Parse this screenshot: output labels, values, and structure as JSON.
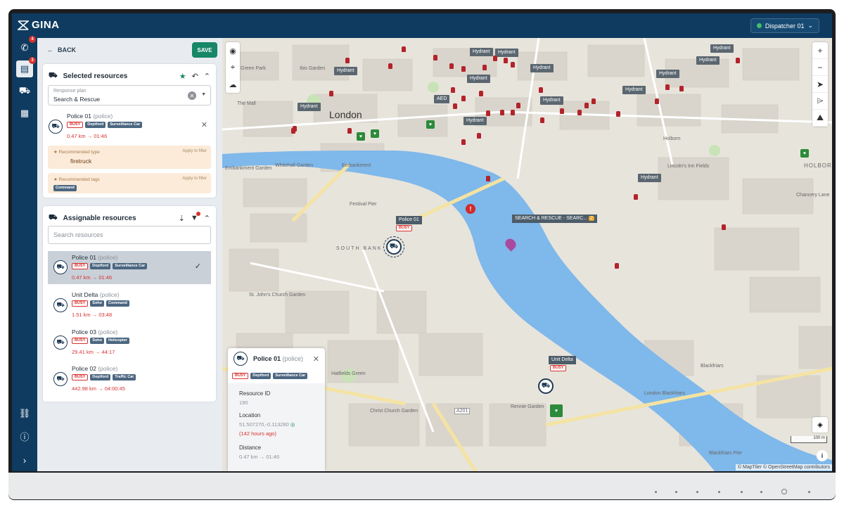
{
  "app": {
    "name": "GINA",
    "dispatcher": "Dispatcher 01"
  },
  "rail": {
    "phone_badge": "4",
    "list_badge": "3"
  },
  "panel": {
    "back_label": "BACK",
    "save_label": "SAVE",
    "selected": {
      "title": "Selected resources",
      "response_plan_label": "Response plan",
      "response_plan_value": "Search & Rescue",
      "resource": {
        "name": "Police 01",
        "type": "(police)",
        "tags": [
          "BUSY",
          "Deptford",
          "Surveillance Car"
        ],
        "distance": "0.47 km → 01:46"
      },
      "rec_type_label": "Recommended type",
      "rec_type_action": "Apply to filter",
      "rec_type_value": "firetruck",
      "rec_tags_label": "Recommended tags",
      "rec_tags_action": "Apply to filter",
      "rec_tags_value": "Command"
    },
    "assignable": {
      "title": "Assignable resources",
      "search_placeholder": "Search resources",
      "items": [
        {
          "name": "Police 01",
          "type": "(police)",
          "tags": [
            "BUSY",
            "Deptford",
            "Surveillance Car"
          ],
          "distance": "0.47 km → 01:46"
        },
        {
          "name": "Unit Delta",
          "type": "(police)",
          "tags": [
            "BUSY",
            "Soho",
            "Command"
          ],
          "distance": "1.51 km → 03:48"
        },
        {
          "name": "Police 03",
          "type": "(police)",
          "tags": [
            "BUSY",
            "Soho",
            "Helicopter"
          ],
          "distance": "29.41 km → 44:17"
        },
        {
          "name": "Police 02",
          "type": "(police)",
          "tags": [
            "BUSY",
            "Deptford",
            "Traffic Car"
          ],
          "distance": "442.98 km → 04:00:45"
        }
      ]
    }
  },
  "map": {
    "city": "London",
    "labels": [
      "SOUTH BANK",
      "Festival Pier",
      "Embankment",
      "Whitehall Garden",
      "St. John's Church Garden",
      "Hatfields Green",
      "Christ Church Garden",
      "Rennie Garden",
      "London Blackfriars",
      "Blackfriars",
      "Blackfriars Pier",
      "Holborn",
      "Lincoln's Inn Fields",
      "Chancery Lane",
      "HOLBOR",
      "A201",
      "Green Park",
      "Ibis Garden",
      "The Mall",
      "Embankment Garden"
    ],
    "hydrant_label": "Hydrant",
    "aed_label": "AED",
    "unit1_label": "Police 01",
    "unit1_status": "BUSY",
    "unit2_label": "Unit Delta",
    "unit2_status": "BUSY",
    "incident_label": "SEARCH & RESCUE - SEARC...",
    "incident_badge": "2",
    "scale_label": "100 m",
    "attribution": "© MapTiler © OpenStreetMap contributors"
  },
  "popup": {
    "name": "Police 01",
    "type": "(police)",
    "tags": [
      "BUSY",
      "Deptford",
      "Surveillance Car"
    ],
    "resource_id_label": "Resource ID",
    "resource_id": "190",
    "location_label": "Location",
    "location": "51.507270,-0.113280",
    "location_age": "(142 hours ago)",
    "distance_label": "Distance",
    "distance": "0.47 km → 01:46"
  },
  "colors": {
    "topbar": "#0f3b60",
    "save": "#178766",
    "busy": "#d7322f",
    "river": "#7fb8ea"
  }
}
